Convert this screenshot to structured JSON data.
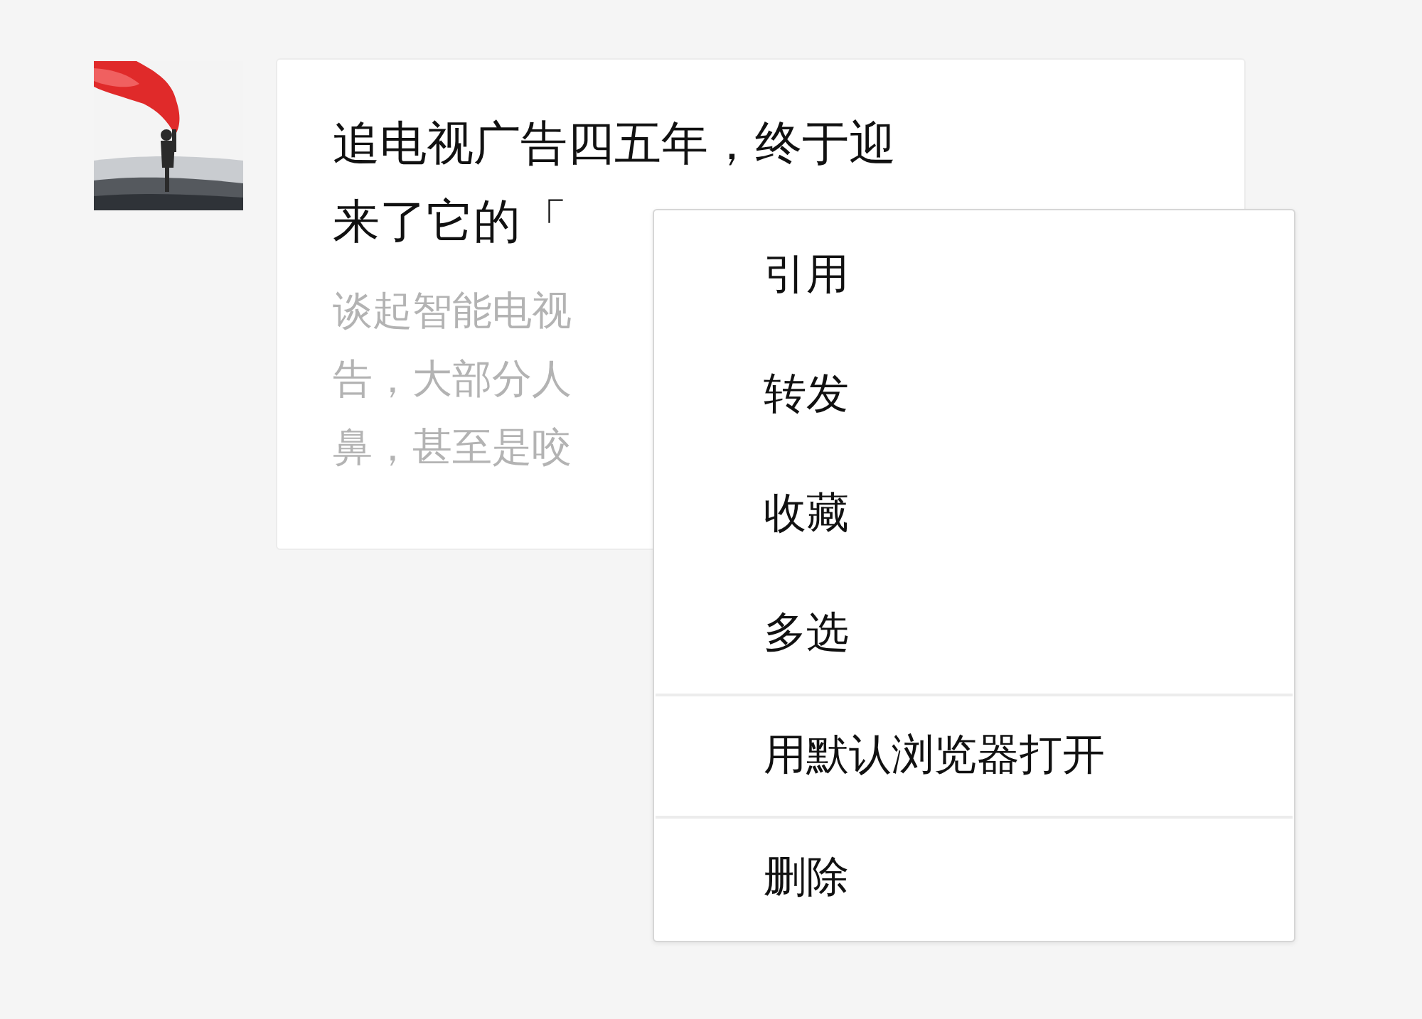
{
  "message": {
    "avatar": {
      "kind": "picture"
    },
    "title_lines": [
      "追电视广告四五年，终于迎",
      "来了它的「"
    ],
    "description_lines": [
      "谈起智能电视",
      "告，大部分人",
      "鼻，甚至是咬"
    ]
  },
  "context_menu": {
    "groups": [
      [
        "引用",
        "转发",
        "收藏",
        "多选"
      ],
      [
        "用默认浏览器打开"
      ],
      [
        "删除"
      ]
    ]
  }
}
